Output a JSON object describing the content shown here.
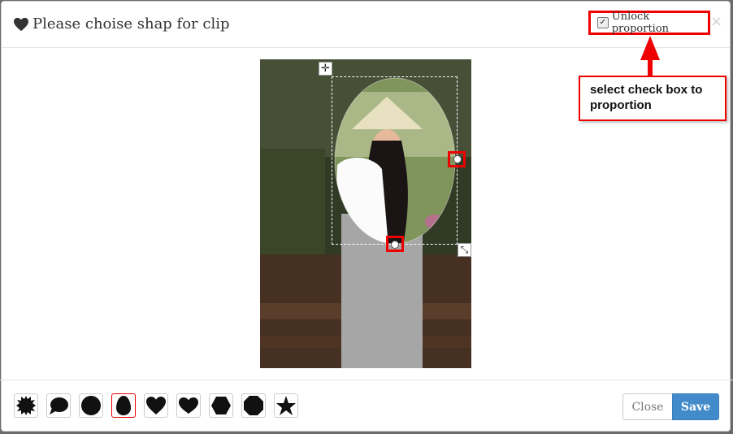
{
  "header": {
    "title": "Please choise shap for clip",
    "title_icon": "heart-icon",
    "unlock_label": "Unlock proportion",
    "unlock_checked": true,
    "close_glyph": "×"
  },
  "callout": {
    "text": "select check box to proportion"
  },
  "editor": {
    "move_glyph": "✛",
    "resize_glyph": "⤡"
  },
  "shapes": [
    {
      "name": "starburst",
      "selected": false
    },
    {
      "name": "speech-bubble",
      "selected": false
    },
    {
      "name": "circle",
      "selected": false
    },
    {
      "name": "egg",
      "selected": true
    },
    {
      "name": "heart",
      "selected": false
    },
    {
      "name": "heart-wide",
      "selected": false
    },
    {
      "name": "hexagon",
      "selected": false
    },
    {
      "name": "octagon",
      "selected": false
    },
    {
      "name": "star",
      "selected": false
    }
  ],
  "footer": {
    "close_label": "Close",
    "save_label": "Save"
  },
  "colors": {
    "highlight": "#ee0000",
    "save_button": "#428bca"
  }
}
